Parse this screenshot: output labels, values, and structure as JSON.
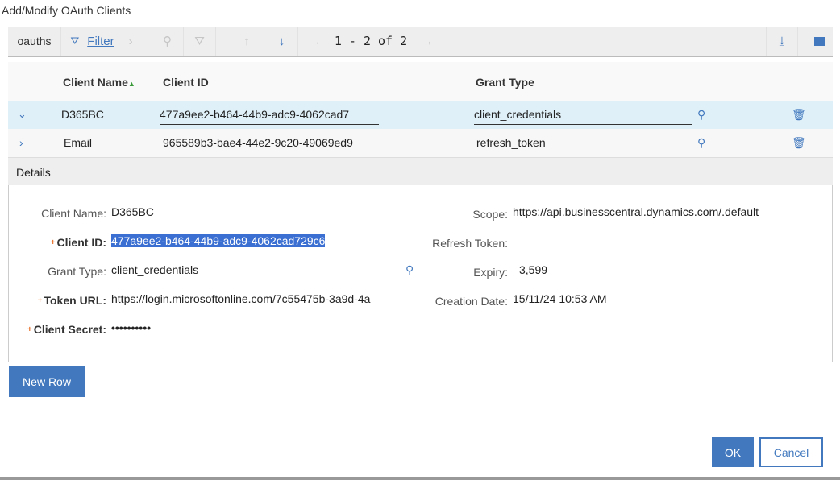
{
  "title": "Add/Modify OAuth Clients",
  "toolbar": {
    "table_name": "oauths",
    "filter": "Filter",
    "pagination": "1 - 2 of 2"
  },
  "table": {
    "headers": [
      "Client Name",
      "Client ID",
      "Grant Type"
    ],
    "rows": [
      {
        "client_name": "D365BC",
        "client_id": "477a9ee2-b464-44b9-adc9-4062cad7",
        "grant_type": "client_credentials"
      },
      {
        "client_name": "Email",
        "client_id": "965589b3-bae4-44e2-9c20-49069ed9",
        "grant_type": "refresh_token"
      }
    ]
  },
  "details": {
    "header": "Details",
    "client_name_label": "Client Name:",
    "client_name": "D365BC",
    "client_id_label": "Client ID:",
    "client_id": "477a9ee2-b464-44b9-adc9-4062cad729c6",
    "grant_type_label": "Grant Type:",
    "grant_type": "client_credentials",
    "token_url_label": "Token URL:",
    "token_url": "https://login.microsoftonline.com/7c55475b-3a9d-4a",
    "client_secret_label": "Client Secret:",
    "client_secret": "••••••••••",
    "scope_label": "Scope:",
    "scope": "https://api.businesscentral.dynamics.com/.default",
    "refresh_token_label": "Refresh Token:",
    "refresh_token": "",
    "expiry_label": "Expiry:",
    "expiry": "3,599",
    "creation_date_label": "Creation Date:",
    "creation_date": "15/11/24 10:53 AM"
  },
  "buttons": {
    "new_row": "New Row",
    "ok": "OK",
    "cancel": "Cancel"
  },
  "colors": {
    "accent": "#4178be",
    "selected_row": "#dff0f8",
    "selection": "#3b6fd1"
  }
}
